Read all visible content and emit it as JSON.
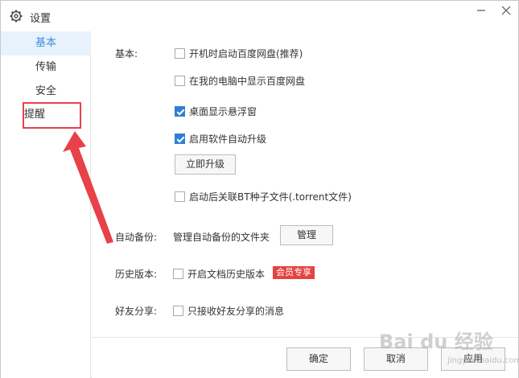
{
  "window": {
    "title": "设置"
  },
  "sidebar": {
    "items": [
      {
        "label": "基本",
        "active": true
      },
      {
        "label": "传输",
        "active": false
      },
      {
        "label": "安全",
        "active": false
      },
      {
        "label": "提醒",
        "active": false
      }
    ]
  },
  "basic": {
    "section_label": "基本:",
    "options": [
      {
        "label": "开机时启动百度网盘(推荐)",
        "checked": false
      },
      {
        "label": "在我的电脑中显示百度网盘",
        "checked": false
      },
      {
        "label": "桌面显示悬浮窗",
        "checked": true
      },
      {
        "label": "启用软件自动升级",
        "checked": true
      }
    ],
    "upgrade_button": "立即升级",
    "bt_option": {
      "label": "启动后关联BT种子文件(.torrent文件)",
      "checked": false
    }
  },
  "backup": {
    "section_label": "自动备份:",
    "description": "管理自动备份的文件夹",
    "manage_button": "管理"
  },
  "history": {
    "section_label": "历史版本:",
    "option": {
      "label": "开启文档历史版本",
      "checked": false
    },
    "badge": "会员专享"
  },
  "share": {
    "section_label": "好友分享:",
    "option": {
      "label": "只接收好友分享的消息",
      "checked": false
    }
  },
  "footer": {
    "ok_button": "确定",
    "cancel_button": "取消",
    "apply_button": "应用"
  },
  "watermark": {
    "brand": "Bai du 经验",
    "sub": "jingyan.baidu.com"
  },
  "colors": {
    "accent": "#3b8fe0",
    "checkbox": "#2f7fd5",
    "annotation_red": "#e8414a",
    "badge_red": "#e64340",
    "active_bg": "#e8f2fc"
  }
}
